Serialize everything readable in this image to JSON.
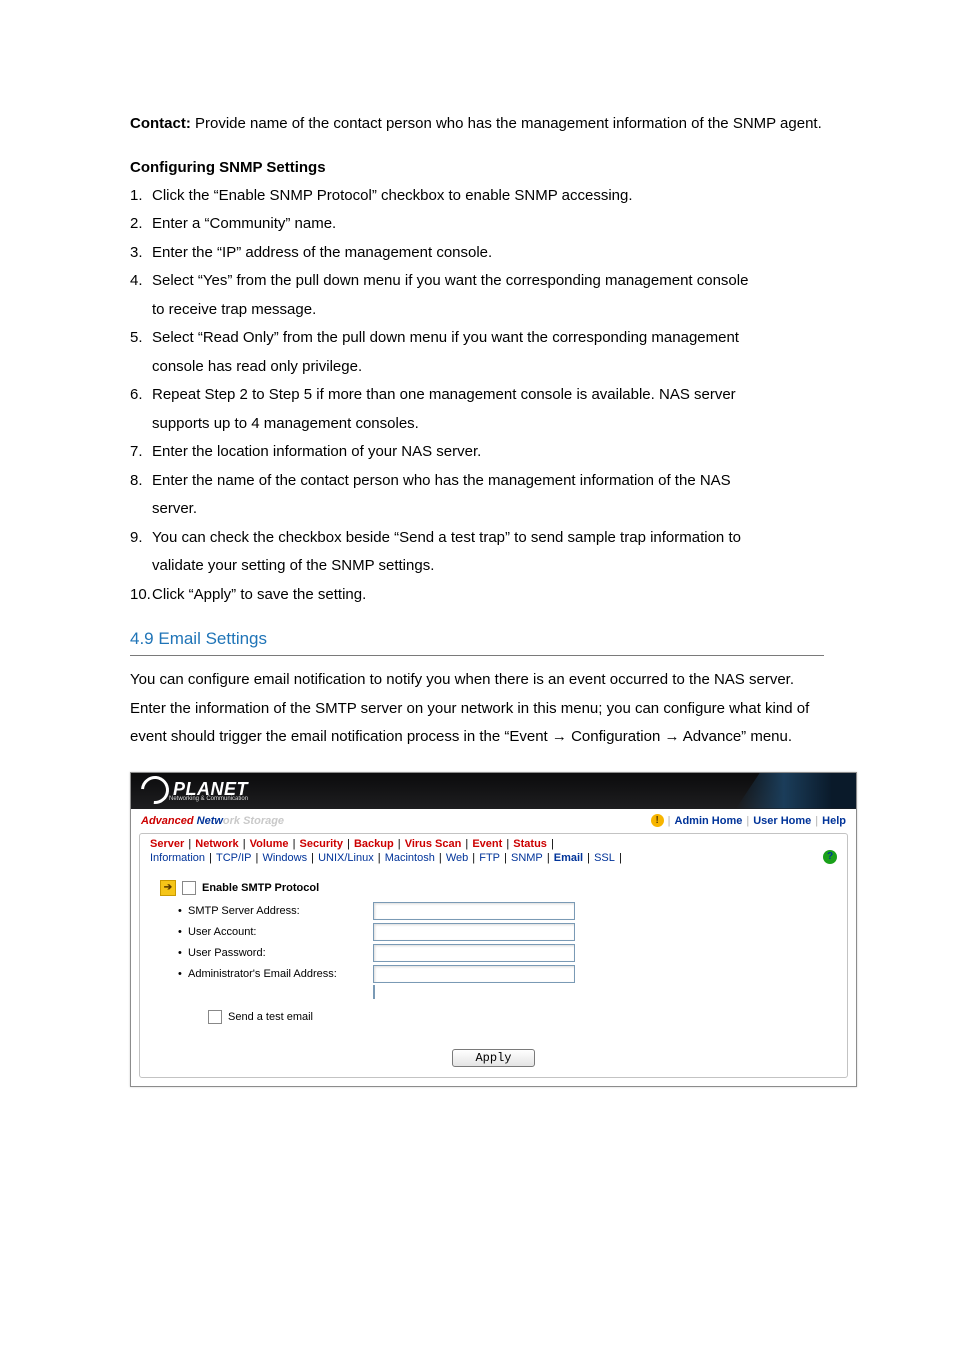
{
  "intro": {
    "contact_label": "Contact:",
    "contact_text": " Provide name of the contact person who has the management information of the SNMP agent."
  },
  "subheading": "Configuring SNMP Settings",
  "steps": [
    {
      "n": "1.",
      "t": "Click the “Enable SNMP Protocol” checkbox to enable SNMP accessing."
    },
    {
      "n": "2.",
      "t": "Enter a “Community” name."
    },
    {
      "n": "3.",
      "t": "Enter the “IP” address of the management console."
    },
    {
      "n": "4.",
      "t": "Select “Yes” from the pull down menu if you want the corresponding management console",
      "cont": "to receive trap message."
    },
    {
      "n": "5.",
      "t": "Select “Read Only” from the pull down menu if you want the corresponding management",
      "cont": "console has read only privilege."
    },
    {
      "n": "6.",
      "t": "Repeat Step 2 to Step 5 if more than one management console is available. NAS server",
      "cont": "supports up to 4 management consoles."
    },
    {
      "n": "7.",
      "t": "Enter the location information of your NAS server."
    },
    {
      "n": "8.",
      "t": "Enter the name of the contact person who has the management information of the NAS",
      "cont": "server."
    },
    {
      "n": "9.",
      "t": "You can check the checkbox beside “Send a test trap” to send sample trap information to",
      "cont": "validate your setting of the SNMP settings."
    },
    {
      "n": "10.",
      "t": "Click “Apply” to save the setting."
    }
  ],
  "section_heading": "4.9 Email Settings",
  "section_body": "You can configure email notification to notify you when there is an event occurred to the NAS server. Enter the information of the SMTP server on your network in this menu; you can configure what kind of event should trigger the email notification process in the “Event → Configuration → Advance” menu.",
  "screenshot": {
    "logo_text": "PLANET",
    "logo_tagline": "Networking & Communication",
    "brand_prefix": "Advanced ",
    "brand_netw": "Netw",
    "brand_suffix": "ork Storage",
    "alert_glyph": "!",
    "header_links": {
      "admin": "Admin Home",
      "user": "User Home",
      "help": "Help"
    },
    "tabs1": [
      "Server",
      "Network",
      "Volume",
      "Security",
      "Backup",
      "Virus Scan",
      "Event",
      "Status"
    ],
    "tabs2": [
      "Information",
      "TCP/IP",
      "Windows",
      "UNIX/Linux",
      "Macintosh",
      "Web",
      "FTP",
      "SNMP",
      "Email",
      "SSL"
    ],
    "tabs2_active": "Email",
    "help_glyph": "?",
    "arrow_glyph": "➔",
    "enable_label": "Enable SMTP Protocol",
    "fields": {
      "smtp": "SMTP Server Address:",
      "user": "User Account:",
      "pass": "User Password:",
      "admin": "Administrator's Email Address:"
    },
    "test_label": "Send a test email",
    "apply_label": "Apply"
  }
}
